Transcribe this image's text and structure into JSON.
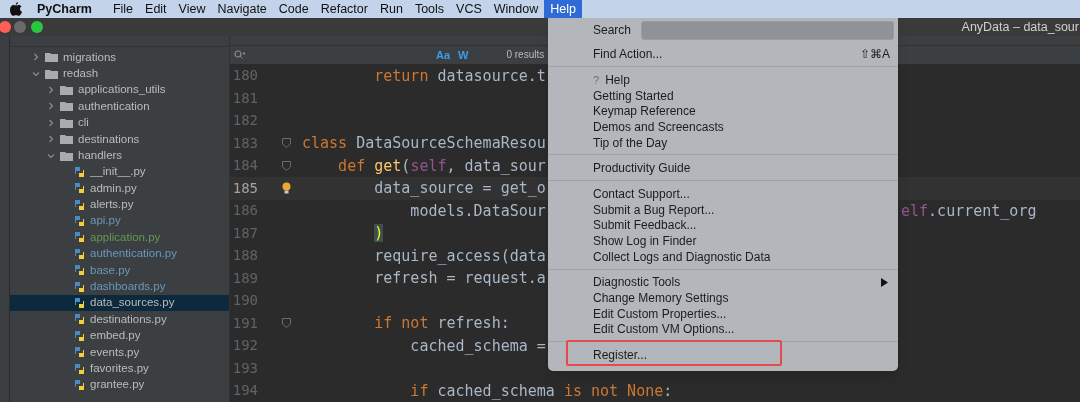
{
  "menu_bar": {
    "app": "PyCharm",
    "items": [
      {
        "label": "File",
        "selected": false
      },
      {
        "label": "Edit",
        "selected": false
      },
      {
        "label": "View",
        "selected": false
      },
      {
        "label": "Navigate",
        "selected": false
      },
      {
        "label": "Code",
        "selected": false
      },
      {
        "label": "Refactor",
        "selected": false
      },
      {
        "label": "Run",
        "selected": false
      },
      {
        "label": "Tools",
        "selected": false
      },
      {
        "label": "VCS",
        "selected": false
      },
      {
        "label": "Window",
        "selected": false
      },
      {
        "label": "Help",
        "selected": true
      }
    ]
  },
  "window": {
    "title": "AnyData – data_sour"
  },
  "project_tree": [
    {
      "name": "migrations",
      "kind": "folder",
      "expanded": false,
      "selected": false
    },
    {
      "name": "redash",
      "kind": "folder",
      "expanded": true,
      "selected": false,
      "children": [
        {
          "name": "applications_utils",
          "kind": "folder",
          "expanded": false,
          "selected": false
        },
        {
          "name": "authentication",
          "kind": "folder",
          "expanded": false,
          "selected": false
        },
        {
          "name": "cli",
          "kind": "folder",
          "expanded": false,
          "selected": false
        },
        {
          "name": "destinations",
          "kind": "folder",
          "expanded": false,
          "selected": false
        },
        {
          "name": "handlers",
          "kind": "folder",
          "expanded": true,
          "selected": false,
          "children": [
            {
              "name": "__init__.py",
              "kind": "file",
              "selected": false
            },
            {
              "name": "admin.py",
              "kind": "file",
              "selected": false
            },
            {
              "name": "alerts.py",
              "kind": "file",
              "selected": false
            },
            {
              "name": "api.py",
              "kind": "file",
              "color": "#6897bb",
              "selected": false
            },
            {
              "name": "application.py",
              "kind": "file",
              "color": "#629755",
              "selected": false
            },
            {
              "name": "authentication.py",
              "kind": "file",
              "color": "#6897bb",
              "selected": false
            },
            {
              "name": "base.py",
              "kind": "file",
              "color": "#6897bb",
              "selected": false
            },
            {
              "name": "dashboards.py",
              "kind": "file",
              "color": "#6897bb",
              "selected": false
            },
            {
              "name": "data_sources.py",
              "kind": "file",
              "selected": true
            },
            {
              "name": "destinations.py",
              "kind": "file",
              "selected": false
            },
            {
              "name": "embed.py",
              "kind": "file",
              "selected": false
            },
            {
              "name": "events.py",
              "kind": "file",
              "selected": false
            },
            {
              "name": "favorites.py",
              "kind": "file",
              "selected": false
            },
            {
              "name": "grantee.py",
              "kind": "file",
              "selected": false
            }
          ]
        }
      ]
    }
  ],
  "find_bar": {
    "case_label": "Aa",
    "word_label": "W",
    "results": "0 results"
  },
  "code_lines": [
    {
      "number": "180",
      "current": false,
      "tokens": [
        {
          "t": "        return",
          "kind": "kw"
        },
        {
          "t": " datasource.t",
          "kind": "plain"
        }
      ]
    },
    {
      "number": "181",
      "current": false
    },
    {
      "number": "182",
      "current": false
    },
    {
      "number": "183",
      "current": false,
      "fold": true,
      "tokens": [
        {
          "t": "class",
          "kind": "kw"
        },
        {
          "t": " DataSourceSchemaResou",
          "kind": "plain"
        }
      ]
    },
    {
      "number": "184",
      "current": false,
      "fold": true,
      "tokens": [
        {
          "t": "    def ",
          "kind": "kw"
        },
        {
          "t": "get",
          "kind": "fn"
        },
        {
          "t": "(",
          "kind": "plain"
        },
        {
          "t": "self",
          "kind": "self"
        },
        {
          "t": ", data_sour",
          "kind": "plain"
        }
      ]
    },
    {
      "number": "185",
      "current": true,
      "bulb": true,
      "tokens": [
        {
          "t": "        data_source = get_o",
          "kind": "plain"
        }
      ]
    },
    {
      "number": "186",
      "current": false,
      "tokens": [
        {
          "t": "            models.DataSour",
          "kind": "plain"
        }
      ],
      "right": [
        {
          "t": "elf",
          "kind": "self"
        },
        {
          "t": ".current_org",
          "kind": "plain"
        }
      ]
    },
    {
      "number": "187",
      "current": false,
      "tokens": [
        {
          "t": "        )",
          "kind": "match"
        }
      ]
    },
    {
      "number": "188",
      "current": false,
      "tokens": [
        {
          "t": "        require_access(data",
          "kind": "plain"
        }
      ]
    },
    {
      "number": "189",
      "current": false,
      "tokens": [
        {
          "t": "        refresh = request.a",
          "kind": "plain"
        }
      ]
    },
    {
      "number": "190",
      "current": false
    },
    {
      "number": "191",
      "current": false,
      "fold": true,
      "tokens": [
        {
          "t": "        if not",
          "kind": "kw"
        },
        {
          "t": " refresh:",
          "kind": "plain"
        }
      ]
    },
    {
      "number": "192",
      "current": false,
      "tokens": [
        {
          "t": "            cached_schema =",
          "kind": "plain"
        }
      ]
    },
    {
      "number": "193",
      "current": false
    },
    {
      "number": "194",
      "current": false,
      "tokens": [
        {
          "t": "            if",
          "kind": "kw"
        },
        {
          "t": " cached_schema ",
          "kind": "plain"
        },
        {
          "t": "is not None",
          "kind": "kw"
        },
        {
          "t": ":",
          "kind": "plain"
        }
      ]
    }
  ],
  "help_menu": {
    "groups": [
      [
        {
          "kind": "search",
          "label": "Search"
        },
        {
          "kind": "action",
          "label": "Find Action...",
          "shortcut": "⇧⌘A"
        }
      ],
      [
        {
          "kind": "help",
          "label": "Help",
          "icon": "?"
        },
        {
          "kind": "action",
          "label": "Getting Started"
        },
        {
          "kind": "action",
          "label": "Keymap Reference"
        },
        {
          "kind": "action",
          "label": "Demos and Screencasts"
        },
        {
          "kind": "action",
          "label": "Tip of the Day"
        }
      ],
      [
        {
          "kind": "action",
          "label": "Productivity Guide"
        }
      ],
      [
        {
          "kind": "action",
          "label": "Contact Support..."
        },
        {
          "kind": "action",
          "label": "Submit a Bug Report..."
        },
        {
          "kind": "action",
          "label": "Submit Feedback..."
        },
        {
          "kind": "action",
          "label": "Show Log in Finder"
        },
        {
          "kind": "action",
          "label": "Collect Logs and Diagnostic Data"
        }
      ],
      [
        {
          "kind": "submenu",
          "label": "Diagnostic Tools"
        },
        {
          "kind": "action",
          "label": "Change Memory Settings"
        },
        {
          "kind": "action",
          "label": "Edit Custom Properties..."
        },
        {
          "kind": "action",
          "label": "Edit Custom VM Options..."
        }
      ],
      [
        {
          "kind": "action",
          "label": "Register...",
          "annotated": true
        }
      ]
    ]
  }
}
